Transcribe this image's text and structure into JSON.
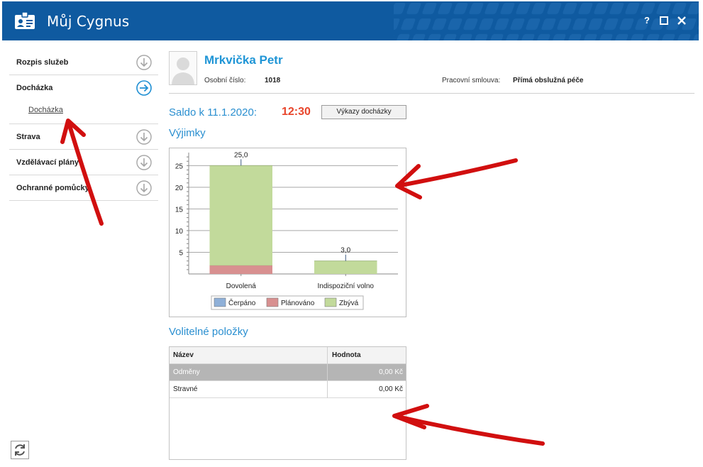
{
  "window": {
    "title": "Můj Cygnus",
    "help": "?",
    "maximize": "□",
    "close": "✕"
  },
  "sidebar": {
    "items": [
      {
        "label": "Rozpis služeb",
        "icon": "chevron-down-circle-icon"
      },
      {
        "label": "Docházka",
        "icon": "arrow-right-circle-icon",
        "active": true,
        "sub": "Docházka"
      },
      {
        "label": "Strava",
        "icon": "chevron-down-circle-icon"
      },
      {
        "label": "Vzdělávací plány",
        "icon": "chevron-down-circle-icon"
      },
      {
        "label": "Ochranné pomůcky",
        "icon": "chevron-down-circle-icon"
      }
    ]
  },
  "person": {
    "name": "Mrkvička Petr",
    "id_label": "Osobní číslo:",
    "id_value": "1018",
    "contract_label": "Pracovní smlouva:",
    "contract_value": "Přímá obslužná péče"
  },
  "saldo": {
    "label": "Saldo k 11.1.2020:",
    "value": "12:30",
    "button": "Výkazy docházky"
  },
  "sections": {
    "exceptions": "Výjimky",
    "optional": "Volitelné položky"
  },
  "chart_data": {
    "type": "bar",
    "stacked": true,
    "categories": [
      "Dovolená",
      "Indispoziční volno"
    ],
    "series": [
      {
        "name": "Čerpáno",
        "values": [
          0,
          0
        ],
        "color": "#8fb0d8"
      },
      {
        "name": "Plánováno",
        "values": [
          2,
          0
        ],
        "color": "#d89090"
      },
      {
        "name": "Zbývá",
        "values": [
          23,
          3
        ],
        "color": "#c2da9b"
      }
    ],
    "total_labels": [
      "25,0",
      "3,0"
    ],
    "y_ticks": [
      5,
      10,
      15,
      20,
      25
    ],
    "ylim": [
      0,
      28
    ],
    "grid": true,
    "legend_position": "bottom"
  },
  "table": {
    "headers": [
      "Název",
      "Hodnota"
    ],
    "rows": [
      {
        "name": "Odměny",
        "value": "0,00 Kč",
        "selected": true
      },
      {
        "name": "Stravné",
        "value": "0,00 Kč",
        "selected": false
      }
    ]
  },
  "colors": {
    "titlebar": "#0f5aa0",
    "accent": "#1f95d6",
    "saldo": "#e8462c",
    "annotation": "#d10f0f"
  }
}
